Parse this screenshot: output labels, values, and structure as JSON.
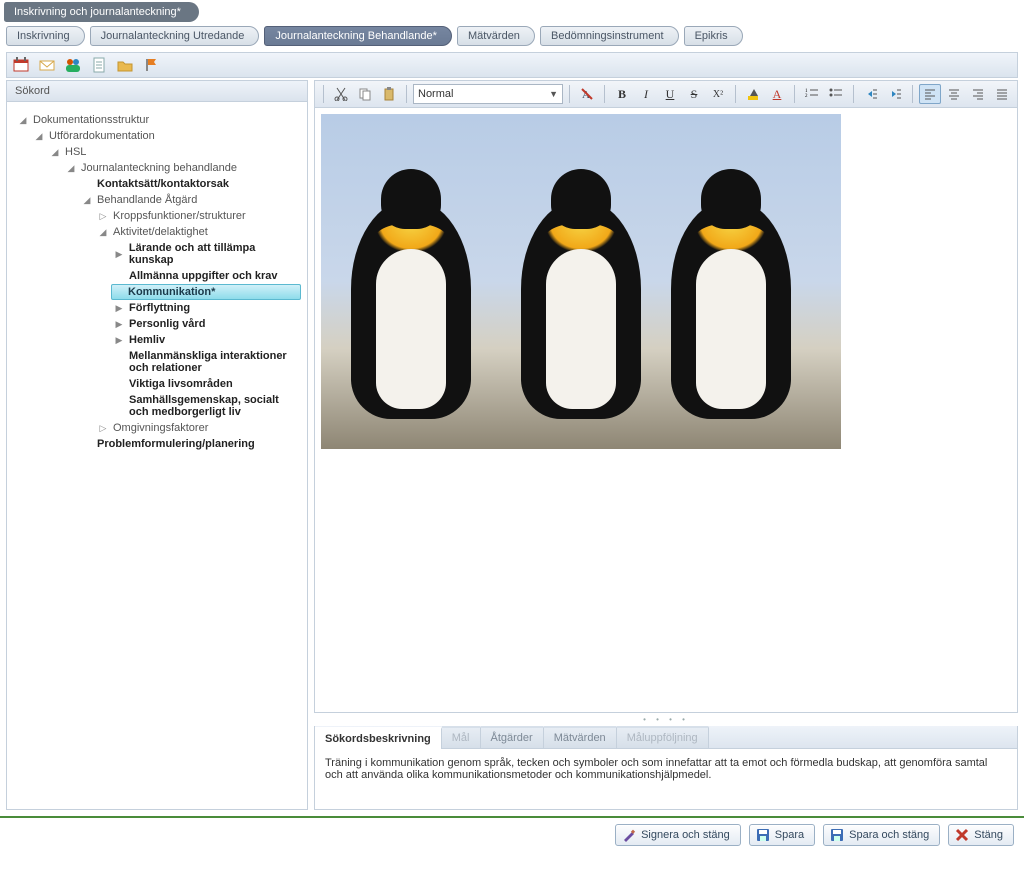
{
  "top_tab": "Inskrivning och journalanteckning*",
  "crumbs": [
    {
      "label": "Inskrivning",
      "active": false
    },
    {
      "label": "Journalanteckning Utredande",
      "active": false
    },
    {
      "label": "Journalanteckning Behandlande*",
      "active": true
    },
    {
      "label": "Mätvärden",
      "active": false
    },
    {
      "label": "Bedömningsinstrument",
      "active": false
    },
    {
      "label": "Epikris",
      "active": false
    }
  ],
  "left_header": "Sökord",
  "tree": {
    "root": "Dokumentationsstruktur",
    "utf": "Utförardokumentation",
    "hsl": "HSL",
    "jb": "Journalanteckning behandlande",
    "kontakt": "Kontaktsätt/kontaktorsak",
    "beh": "Behandlande Åtgärd",
    "kropp": "Kroppsfunktioner/strukturer",
    "akt": "Aktivitet/delaktighet",
    "larande": "Lärande och att tillämpa kunskap",
    "allm": "Allmänna uppgifter och krav",
    "komm": "Kommunikation*",
    "forfl": "Förflyttning",
    "pers": "Personlig vård",
    "hem": "Hemliv",
    "mellan": "Mellanmänskliga interaktioner och relationer",
    "vikt": "Viktiga livsområden",
    "sam": "Samhällsgemenskap, socialt och medborgerligt liv",
    "omg": "Omgivningsfaktorer",
    "prob": "Problemformulering/planering"
  },
  "style_select": "Normal",
  "bottom_tabs": {
    "t1": "Sökordsbeskrivning",
    "t2": "Mål",
    "t3": "Åtgärder",
    "t4": "Mätvärden",
    "t5": "Måluppföljning"
  },
  "desc_text": "Träning i kommunikation genom språk, tecken och symboler och som innefattar att ta emot och förmedla budskap, att genomföra samtal och att använda olika kommunikationsmetoder och kommunikationshjälpmedel.",
  "footer": {
    "sign": "Signera och stäng",
    "save": "Spara",
    "save_close": "Spara och stäng",
    "close": "Stäng"
  }
}
